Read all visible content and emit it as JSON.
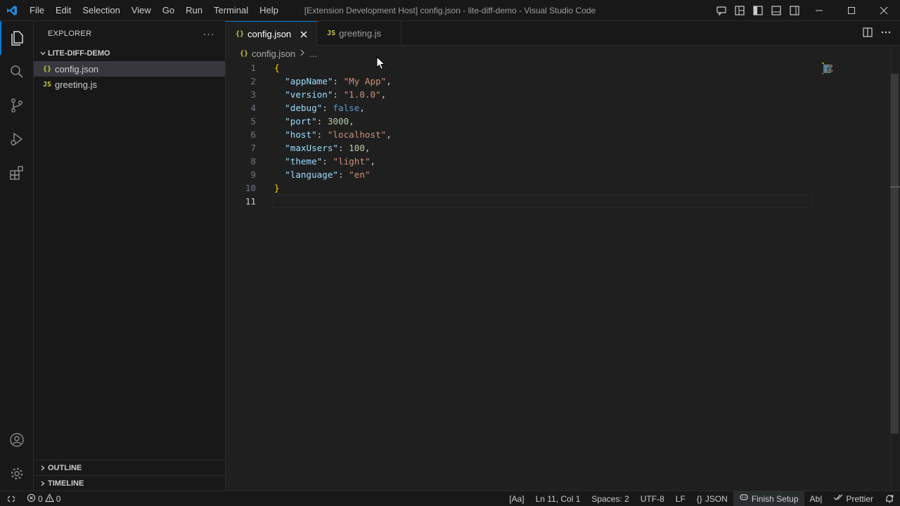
{
  "titlebar": {
    "menu": [
      "File",
      "Edit",
      "Selection",
      "View",
      "Go",
      "Run",
      "Terminal",
      "Help"
    ],
    "window_title": "[Extension Development Host] config.json - lite-diff-demo - Visual Studio Code"
  },
  "sidebar": {
    "title": "EXPLORER",
    "more": "···",
    "folder": "LITE-DIFF-DEMO",
    "files": [
      {
        "icon": "{}",
        "name": "config.json"
      },
      {
        "icon": "JS",
        "name": "greeting.js"
      }
    ],
    "outline": "OUTLINE",
    "timeline": "TIMELINE"
  },
  "tabs": [
    {
      "icon": "{}",
      "label": "config.json"
    },
    {
      "icon": "JS",
      "label": "greeting.js"
    }
  ],
  "breadcrumb": {
    "icon": "{}",
    "file": "config.json",
    "more": "..."
  },
  "code": {
    "line_numbers": [
      "1",
      "2",
      "3",
      "4",
      "5",
      "6",
      "7",
      "8",
      "9",
      "10",
      "11"
    ],
    "lines": [
      [
        {
          "t": "{",
          "c": "br"
        }
      ],
      [
        {
          "t": "  \"appName\"",
          "c": "k"
        },
        {
          "t": ": ",
          "c": "p"
        },
        {
          "t": "\"My App\"",
          "c": "s"
        },
        {
          "t": ",",
          "c": "p"
        }
      ],
      [
        {
          "t": "  \"version\"",
          "c": "k"
        },
        {
          "t": ": ",
          "c": "p"
        },
        {
          "t": "\"1.0.0\"",
          "c": "s"
        },
        {
          "t": ",",
          "c": "p"
        }
      ],
      [
        {
          "t": "  \"debug\"",
          "c": "k"
        },
        {
          "t": ": ",
          "c": "p"
        },
        {
          "t": "false",
          "c": "b"
        },
        {
          "t": ",",
          "c": "p"
        }
      ],
      [
        {
          "t": "  \"port\"",
          "c": "k"
        },
        {
          "t": ": ",
          "c": "p"
        },
        {
          "t": "3000",
          "c": "n"
        },
        {
          "t": ",",
          "c": "p"
        }
      ],
      [
        {
          "t": "  \"host\"",
          "c": "k"
        },
        {
          "t": ": ",
          "c": "p"
        },
        {
          "t": "\"localhost\"",
          "c": "s"
        },
        {
          "t": ",",
          "c": "p"
        }
      ],
      [
        {
          "t": "  \"maxUsers\"",
          "c": "k"
        },
        {
          "t": ": ",
          "c": "p"
        },
        {
          "t": "100",
          "c": "n"
        },
        {
          "t": ",",
          "c": "p"
        }
      ],
      [
        {
          "t": "  \"theme\"",
          "c": "k"
        },
        {
          "t": ": ",
          "c": "p"
        },
        {
          "t": "\"light\"",
          "c": "s"
        },
        {
          "t": ",",
          "c": "p"
        }
      ],
      [
        {
          "t": "  \"language\"",
          "c": "k"
        },
        {
          "t": ": ",
          "c": "p"
        },
        {
          "t": "\"en\"",
          "c": "s"
        }
      ],
      [
        {
          "t": "}",
          "c": "br"
        }
      ],
      []
    ],
    "current_line": 11
  },
  "statusbar": {
    "errors": "0",
    "warnings": "0",
    "search_mode": "[Aa]",
    "position": "Ln 11, Col 1",
    "spaces": "Spaces: 2",
    "encoding": "UTF-8",
    "eol": "LF",
    "language_icon": "{}",
    "language": "JSON",
    "finish_setup": "Finish Setup",
    "spell": "Ab|",
    "prettier": "Prettier"
  },
  "colors": {
    "accent": "#0078d4",
    "vscode_blue": "#2489db",
    "json_icon": "#cbcb41"
  }
}
